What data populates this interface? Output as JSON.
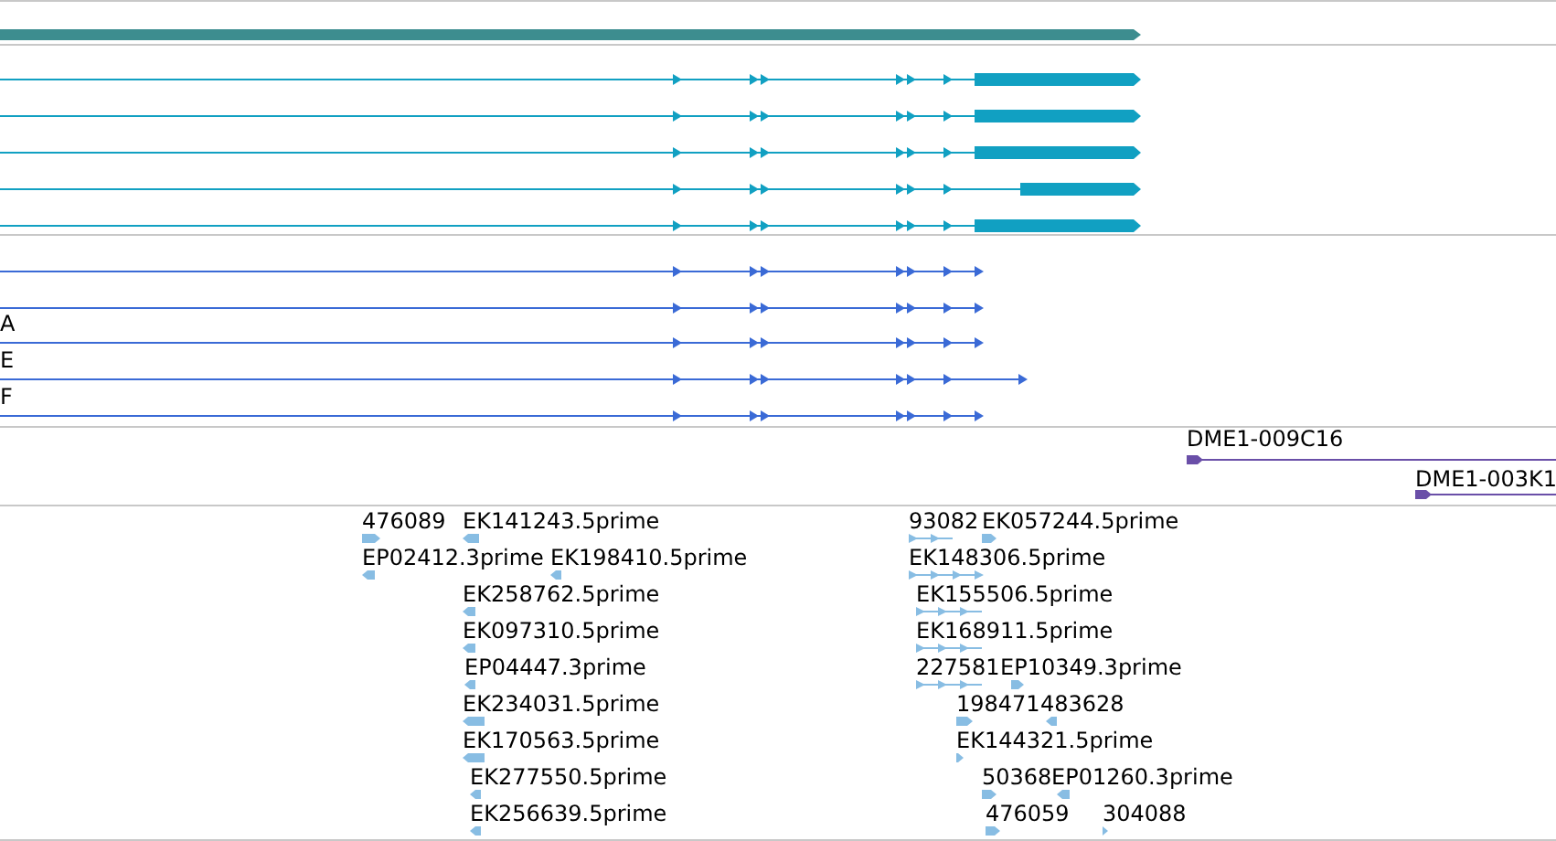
{
  "gene_track": {
    "genes": [
      {
        "kind": "gene"
      }
    ]
  },
  "transcript_track": {
    "transcripts": [
      {
        "kind": "full_cds"
      },
      {
        "kind": "full_cds"
      },
      {
        "kind": "full_cds"
      },
      {
        "kind": "short_cds"
      },
      {
        "kind": "full_cds"
      }
    ]
  },
  "protein_track": {
    "transcripts": [
      {
        "kind": "standard"
      },
      {
        "kind": "standard"
      },
      {
        "kind": "standard",
        "label": "A"
      },
      {
        "kind": "extended",
        "label": "E"
      },
      {
        "kind": "standard",
        "label": "F"
      }
    ]
  },
  "clone_track": {
    "clones": [
      {
        "label": "DME1-009C16"
      },
      {
        "label": "DME1-003K1"
      }
    ]
  },
  "est_track": {
    "ests": [
      {
        "label": "476089",
        "reverse": false,
        "kind": "single"
      },
      {
        "label": "EK141243.5prime",
        "reverse": true,
        "kind": "single"
      },
      {
        "label": "93082",
        "reverse": false,
        "kind": "spliced"
      },
      {
        "label": "EK057244.5prime",
        "reverse": false,
        "kind": "single"
      },
      {
        "label": "EP02412.3prime",
        "reverse": true,
        "kind": "single"
      },
      {
        "label": "EK198410.5prime",
        "reverse": true,
        "kind": "single"
      },
      {
        "label": "EK148306.5prime",
        "reverse": false,
        "kind": "spliced"
      },
      {
        "label": "EK258762.5prime",
        "reverse": true,
        "kind": "single"
      },
      {
        "label": "EK155506.5prime",
        "reverse": false,
        "kind": "spliced"
      },
      {
        "label": "EK097310.5prime",
        "reverse": true,
        "kind": "single"
      },
      {
        "label": "EK168911.5prime",
        "reverse": false,
        "kind": "spliced"
      },
      {
        "label": "EP04447.3prime",
        "reverse": true,
        "kind": "single"
      },
      {
        "label": "227581",
        "reverse": false,
        "kind": "spliced"
      },
      {
        "label": "EP10349.3prime",
        "reverse": false,
        "kind": "single"
      },
      {
        "label": "EK234031.5prime",
        "reverse": true,
        "kind": "single"
      },
      {
        "label": "198471",
        "reverse": false,
        "kind": "single"
      },
      {
        "label": "483628",
        "reverse": true,
        "kind": "single"
      },
      {
        "label": "EK170563.5prime",
        "reverse": true,
        "kind": "single"
      },
      {
        "label": "EK144321.5prime",
        "reverse": false,
        "kind": "single"
      },
      {
        "label": "EK277550.5prime",
        "reverse": true,
        "kind": "single"
      },
      {
        "label": "50368",
        "reverse": false,
        "kind": "single"
      },
      {
        "label": "EP01260.3prime",
        "reverse": true,
        "kind": "single"
      },
      {
        "label": "EK256639.5prime",
        "reverse": true,
        "kind": "single"
      },
      {
        "label": "476059",
        "reverse": false,
        "kind": "single"
      },
      {
        "label": "304088",
        "reverse": false,
        "kind": "single"
      }
    ]
  }
}
